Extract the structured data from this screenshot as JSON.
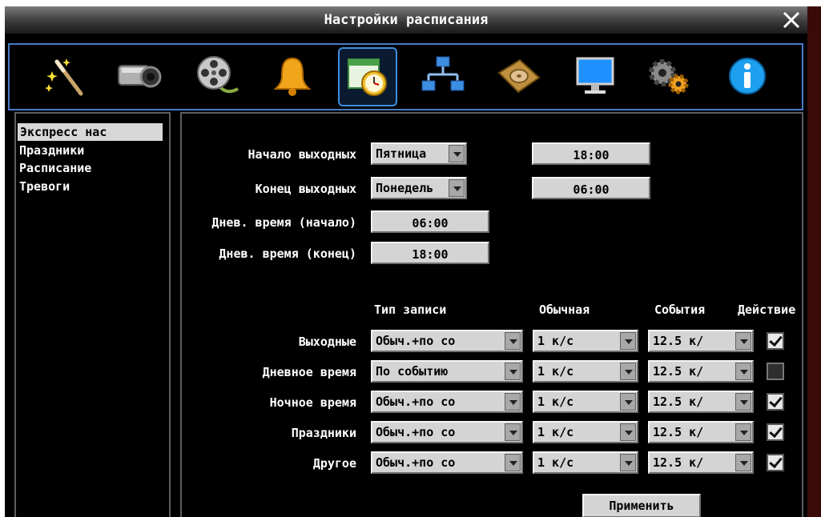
{
  "window": {
    "title": "Настройки расписания"
  },
  "toolbar": {
    "icons": [
      "magic-wand-icon",
      "camera-icon",
      "film-reel-icon",
      "bell-icon",
      "schedule-calendar-icon",
      "network-icon",
      "hard-disk-icon",
      "monitor-icon",
      "gears-icon",
      "info-icon"
    ],
    "selected_index": 4
  },
  "nav": {
    "items": [
      {
        "label": "Экспресс нас",
        "active": true
      },
      {
        "label": "Праздники",
        "active": false
      },
      {
        "label": "Расписание",
        "active": false
      },
      {
        "label": "Тревоги",
        "active": false
      }
    ]
  },
  "weekend": {
    "start_label": "Начало выходных",
    "start_day": "Пятница",
    "start_time": "18:00",
    "end_label": "Конец выходных",
    "end_day": "Понедель",
    "end_time": "06:00"
  },
  "daytime": {
    "start_label": "Днев. время (начало)",
    "start_value": "06:00",
    "end_label": "Днев. время (конец)",
    "end_value": "18:00"
  },
  "table": {
    "headers": {
      "type": "Тип записи",
      "normal": "Обычная",
      "events": "События",
      "action": "Действие"
    },
    "rows": [
      {
        "label": "Выходные",
        "type": "Обыч.+по со",
        "normal": "1 к/с",
        "events": "12.5 к/",
        "checked": true
      },
      {
        "label": "Дневное время",
        "type": "По событию",
        "normal": "1 к/с",
        "events": "12.5 к/",
        "checked": false
      },
      {
        "label": "Ночное время",
        "type": "Обыч.+по со",
        "normal": "1 к/с",
        "events": "12.5 к/",
        "checked": true
      },
      {
        "label": "Праздники",
        "type": "Обыч.+по со",
        "normal": "1 к/с",
        "events": "12.5 к/",
        "checked": true
      },
      {
        "label": "Другое",
        "type": "Обыч.+по со",
        "normal": "1 к/с",
        "events": "12.5 к/",
        "checked": true
      }
    ]
  },
  "apply_label": "Применить",
  "colors": {
    "toolbar_border": "#4a7cc4",
    "panel_border": "#5e5e5e",
    "field_bg": "#d4d4d4"
  }
}
